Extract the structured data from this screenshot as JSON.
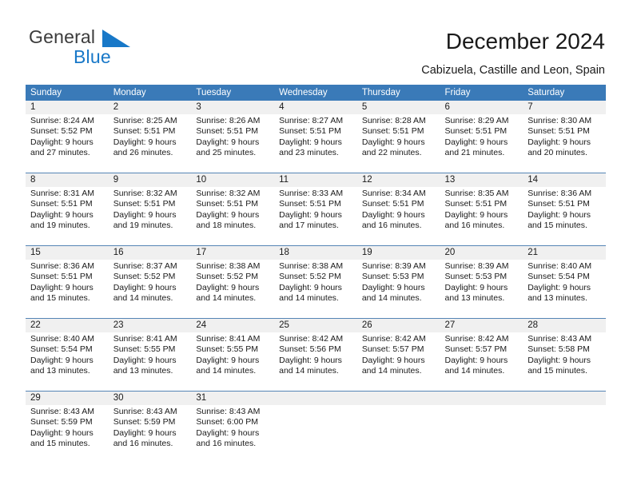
{
  "brand": {
    "name_dark": "General",
    "name_blue": "Blue",
    "triangle_color": "#1878c8",
    "dark_color": "#3b3b3b",
    "blue_color": "#1878c8"
  },
  "header": {
    "title": "December 2024",
    "subtitle": "Cabizuela, Castille and Leon, Spain"
  },
  "calendar": {
    "header_bg": "#3a7ab8",
    "daynum_band_bg": "#f0f0f0",
    "row_separator_color": "#5585b5",
    "weekdays": [
      "Sunday",
      "Monday",
      "Tuesday",
      "Wednesday",
      "Thursday",
      "Friday",
      "Saturday"
    ],
    "weeks": [
      [
        {
          "day": "1",
          "sunrise": "Sunrise: 8:24 AM",
          "sunset": "Sunset: 5:52 PM",
          "daylight_1": "Daylight: 9 hours",
          "daylight_2": "and 27 minutes."
        },
        {
          "day": "2",
          "sunrise": "Sunrise: 8:25 AM",
          "sunset": "Sunset: 5:51 PM",
          "daylight_1": "Daylight: 9 hours",
          "daylight_2": "and 26 minutes."
        },
        {
          "day": "3",
          "sunrise": "Sunrise: 8:26 AM",
          "sunset": "Sunset: 5:51 PM",
          "daylight_1": "Daylight: 9 hours",
          "daylight_2": "and 25 minutes."
        },
        {
          "day": "4",
          "sunrise": "Sunrise: 8:27 AM",
          "sunset": "Sunset: 5:51 PM",
          "daylight_1": "Daylight: 9 hours",
          "daylight_2": "and 23 minutes."
        },
        {
          "day": "5",
          "sunrise": "Sunrise: 8:28 AM",
          "sunset": "Sunset: 5:51 PM",
          "daylight_1": "Daylight: 9 hours",
          "daylight_2": "and 22 minutes."
        },
        {
          "day": "6",
          "sunrise": "Sunrise: 8:29 AM",
          "sunset": "Sunset: 5:51 PM",
          "daylight_1": "Daylight: 9 hours",
          "daylight_2": "and 21 minutes."
        },
        {
          "day": "7",
          "sunrise": "Sunrise: 8:30 AM",
          "sunset": "Sunset: 5:51 PM",
          "daylight_1": "Daylight: 9 hours",
          "daylight_2": "and 20 minutes."
        }
      ],
      [
        {
          "day": "8",
          "sunrise": "Sunrise: 8:31 AM",
          "sunset": "Sunset: 5:51 PM",
          "daylight_1": "Daylight: 9 hours",
          "daylight_2": "and 19 minutes."
        },
        {
          "day": "9",
          "sunrise": "Sunrise: 8:32 AM",
          "sunset": "Sunset: 5:51 PM",
          "daylight_1": "Daylight: 9 hours",
          "daylight_2": "and 19 minutes."
        },
        {
          "day": "10",
          "sunrise": "Sunrise: 8:32 AM",
          "sunset": "Sunset: 5:51 PM",
          "daylight_1": "Daylight: 9 hours",
          "daylight_2": "and 18 minutes."
        },
        {
          "day": "11",
          "sunrise": "Sunrise: 8:33 AM",
          "sunset": "Sunset: 5:51 PM",
          "daylight_1": "Daylight: 9 hours",
          "daylight_2": "and 17 minutes."
        },
        {
          "day": "12",
          "sunrise": "Sunrise: 8:34 AM",
          "sunset": "Sunset: 5:51 PM",
          "daylight_1": "Daylight: 9 hours",
          "daylight_2": "and 16 minutes."
        },
        {
          "day": "13",
          "sunrise": "Sunrise: 8:35 AM",
          "sunset": "Sunset: 5:51 PM",
          "daylight_1": "Daylight: 9 hours",
          "daylight_2": "and 16 minutes."
        },
        {
          "day": "14",
          "sunrise": "Sunrise: 8:36 AM",
          "sunset": "Sunset: 5:51 PM",
          "daylight_1": "Daylight: 9 hours",
          "daylight_2": "and 15 minutes."
        }
      ],
      [
        {
          "day": "15",
          "sunrise": "Sunrise: 8:36 AM",
          "sunset": "Sunset: 5:51 PM",
          "daylight_1": "Daylight: 9 hours",
          "daylight_2": "and 15 minutes."
        },
        {
          "day": "16",
          "sunrise": "Sunrise: 8:37 AM",
          "sunset": "Sunset: 5:52 PM",
          "daylight_1": "Daylight: 9 hours",
          "daylight_2": "and 14 minutes."
        },
        {
          "day": "17",
          "sunrise": "Sunrise: 8:38 AM",
          "sunset": "Sunset: 5:52 PM",
          "daylight_1": "Daylight: 9 hours",
          "daylight_2": "and 14 minutes."
        },
        {
          "day": "18",
          "sunrise": "Sunrise: 8:38 AM",
          "sunset": "Sunset: 5:52 PM",
          "daylight_1": "Daylight: 9 hours",
          "daylight_2": "and 14 minutes."
        },
        {
          "day": "19",
          "sunrise": "Sunrise: 8:39 AM",
          "sunset": "Sunset: 5:53 PM",
          "daylight_1": "Daylight: 9 hours",
          "daylight_2": "and 14 minutes."
        },
        {
          "day": "20",
          "sunrise": "Sunrise: 8:39 AM",
          "sunset": "Sunset: 5:53 PM",
          "daylight_1": "Daylight: 9 hours",
          "daylight_2": "and 13 minutes."
        },
        {
          "day": "21",
          "sunrise": "Sunrise: 8:40 AM",
          "sunset": "Sunset: 5:54 PM",
          "daylight_1": "Daylight: 9 hours",
          "daylight_2": "and 13 minutes."
        }
      ],
      [
        {
          "day": "22",
          "sunrise": "Sunrise: 8:40 AM",
          "sunset": "Sunset: 5:54 PM",
          "daylight_1": "Daylight: 9 hours",
          "daylight_2": "and 13 minutes."
        },
        {
          "day": "23",
          "sunrise": "Sunrise: 8:41 AM",
          "sunset": "Sunset: 5:55 PM",
          "daylight_1": "Daylight: 9 hours",
          "daylight_2": "and 13 minutes."
        },
        {
          "day": "24",
          "sunrise": "Sunrise: 8:41 AM",
          "sunset": "Sunset: 5:55 PM",
          "daylight_1": "Daylight: 9 hours",
          "daylight_2": "and 14 minutes."
        },
        {
          "day": "25",
          "sunrise": "Sunrise: 8:42 AM",
          "sunset": "Sunset: 5:56 PM",
          "daylight_1": "Daylight: 9 hours",
          "daylight_2": "and 14 minutes."
        },
        {
          "day": "26",
          "sunrise": "Sunrise: 8:42 AM",
          "sunset": "Sunset: 5:57 PM",
          "daylight_1": "Daylight: 9 hours",
          "daylight_2": "and 14 minutes."
        },
        {
          "day": "27",
          "sunrise": "Sunrise: 8:42 AM",
          "sunset": "Sunset: 5:57 PM",
          "daylight_1": "Daylight: 9 hours",
          "daylight_2": "and 14 minutes."
        },
        {
          "day": "28",
          "sunrise": "Sunrise: 8:43 AM",
          "sunset": "Sunset: 5:58 PM",
          "daylight_1": "Daylight: 9 hours",
          "daylight_2": "and 15 minutes."
        }
      ],
      [
        {
          "day": "29",
          "sunrise": "Sunrise: 8:43 AM",
          "sunset": "Sunset: 5:59 PM",
          "daylight_1": "Daylight: 9 hours",
          "daylight_2": "and 15 minutes."
        },
        {
          "day": "30",
          "sunrise": "Sunrise: 8:43 AM",
          "sunset": "Sunset: 5:59 PM",
          "daylight_1": "Daylight: 9 hours",
          "daylight_2": "and 16 minutes."
        },
        {
          "day": "31",
          "sunrise": "Sunrise: 8:43 AM",
          "sunset": "Sunset: 6:00 PM",
          "daylight_1": "Daylight: 9 hours",
          "daylight_2": "and 16 minutes."
        },
        {
          "day": "",
          "sunrise": "",
          "sunset": "",
          "daylight_1": "",
          "daylight_2": ""
        },
        {
          "day": "",
          "sunrise": "",
          "sunset": "",
          "daylight_1": "",
          "daylight_2": ""
        },
        {
          "day": "",
          "sunrise": "",
          "sunset": "",
          "daylight_1": "",
          "daylight_2": ""
        },
        {
          "day": "",
          "sunrise": "",
          "sunset": "",
          "daylight_1": "",
          "daylight_2": ""
        }
      ]
    ]
  }
}
